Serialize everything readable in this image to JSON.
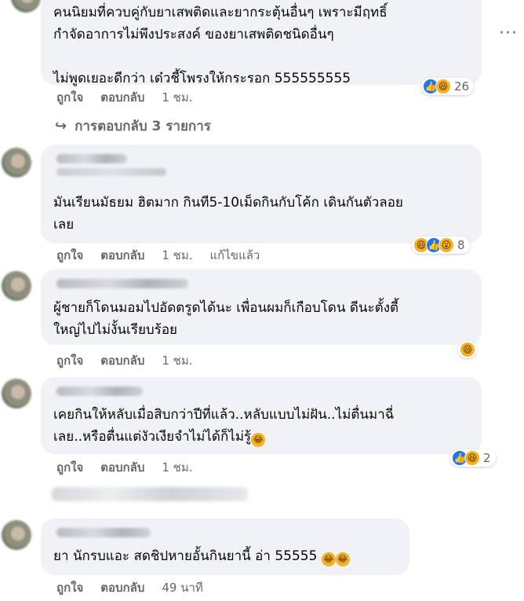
{
  "comments": [
    {
      "text": "คนนิยมที่ควบคู่กับยาเสพติดและยากระตุ้นอื่นๆ เพราะมีฤทธิ์\nกำจัดอาการไม่พึงประสงค์ ของยาเสพติดชนิดอื่นๆ\n\nไม่พูดเยอะดีกว่า เด๋วชี้โพรงให้กระรอก 555555555",
      "reaction_count": "26",
      "like_label": "ถูกใจ",
      "reply_label": "ตอบกลับ",
      "time": "1 ชม.",
      "view_replies": "การตอบกลับ 3 รายการ"
    },
    {
      "text": "มันเรียนมัธยม ฮิตมาก กินที5-10เม็ดกินกับโค้ก เดินกันตัวลอย\nเลย",
      "reaction_count": "8",
      "like_label": "ถูกใจ",
      "reply_label": "ตอบกลับ",
      "time": "1 ชม.",
      "edited": "แก้ไขแล้ว"
    },
    {
      "text": "ผู้ชายก็โดนมอมไปอัดตรูดได้นะ เพื่อนผมก็เกือบโดน ดีนะตั้งตี้\nใหญ่ไปไม่งั้นเรียบร้อย",
      "like_label": "ถูกใจ",
      "reply_label": "ตอบกลับ",
      "time": "1 ชม."
    },
    {
      "text": "เคยกินให้หลับเมื่อสิบกว่าปีที่แล้ว..หลับแบบไม่ฝัน..ไม่ตื่นมาฉี่\nเลย..หรือตื่นแต่งัวเงียจำไม่ได้ก็ไม่รู้",
      "reaction_count": "2",
      "like_label": "ถูกใจ",
      "reply_label": "ตอบกลับ",
      "time": "1 ชม."
    },
    {
      "text": "ยา นักรบแอะ สดชิปหายอั้นกินยานี้ อ่า 55555",
      "like_label": "ถูกใจ",
      "reply_label": "ตอบกลับ",
      "time": "49 นาที"
    }
  ],
  "icons": {
    "more": "more-horizontal-icon",
    "reply_arrow": "reply-arrow-icon",
    "like": "like-reaction-icon",
    "haha": "haha-reaction-icon",
    "wow": "wow-reaction-icon"
  },
  "colors": {
    "bubble": "#f0f2f5",
    "secondary_text": "#65676b",
    "like_blue": "#1877f2",
    "emoji_yellow": "#f7b125"
  }
}
